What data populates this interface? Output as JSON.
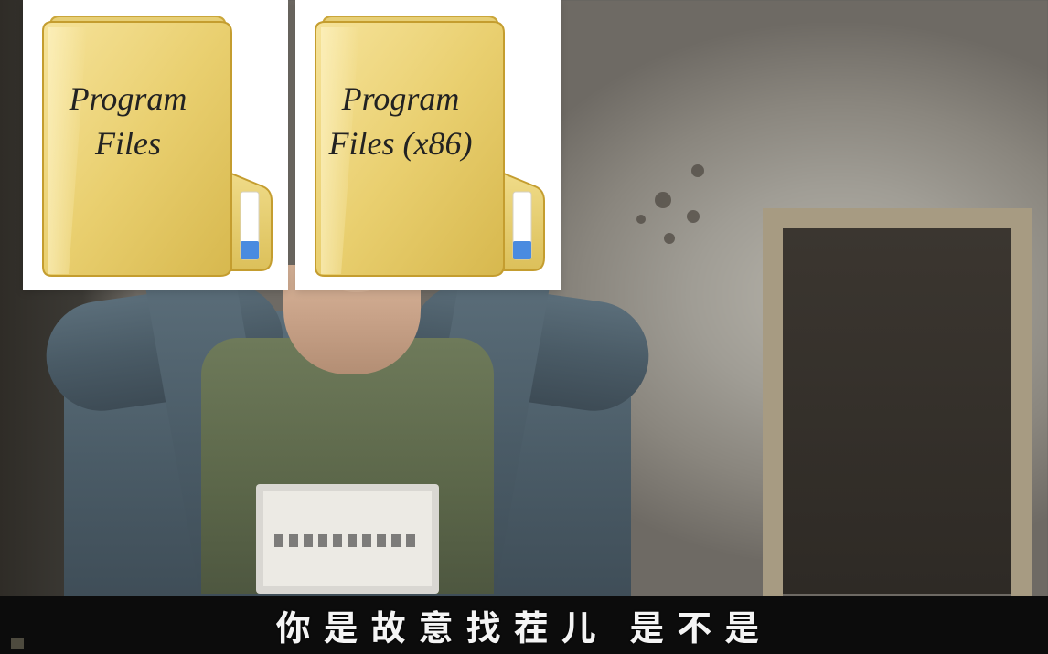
{
  "folders": [
    {
      "label": "Program\nFiles"
    },
    {
      "label": "Program\nFiles (x86)"
    }
  ],
  "subtitle": "你是故意找茬儿 是不是",
  "icons": {
    "folder": "folder-icon"
  }
}
